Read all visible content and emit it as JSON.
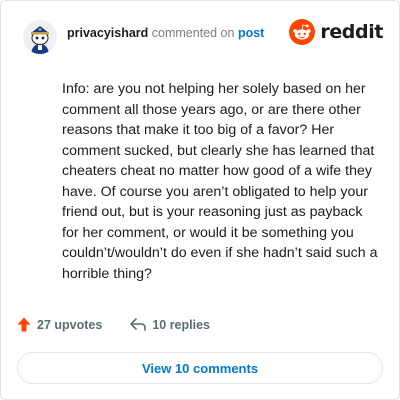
{
  "header": {
    "username": "privacyishard",
    "action": "commented on",
    "target": "post",
    "brand": "reddit"
  },
  "comment": {
    "text": "Info: are you not helping her solely based on her comment all those years ago, or are there other reasons that make it too big of a favor? Her comment sucked, but clearly she has learned that cheaters cheat no matter how good of a wife they have. Of course you aren’t obligated to help your friend out, but is your reasoning just as payback for her comment, or would it be something you couldn’t/wouldn’t do even if she hadn’t said such a horrible thing?"
  },
  "stats": {
    "upvotes": "27 upvotes",
    "replies": "10 replies"
  },
  "view_button": "View 10 comments",
  "colors": {
    "brand": "#ff4500",
    "link": "#0079d3",
    "muted": "#576f76"
  },
  "icons": {
    "avatar": "snoo-avatar",
    "logo": "reddit-logo-icon",
    "upvote": "upvote-arrow-icon",
    "reply": "reply-arrow-icon"
  }
}
